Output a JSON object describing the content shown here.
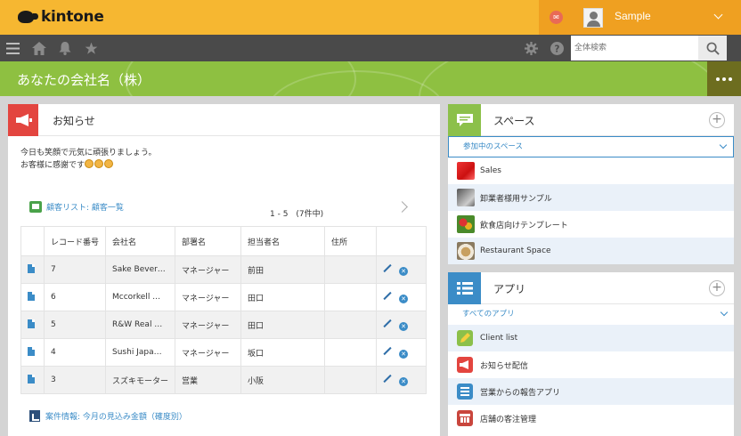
{
  "brand": {
    "name": "kintone"
  },
  "user": {
    "name": "Sample"
  },
  "search": {
    "placeholder": "全体検索"
  },
  "nav": {
    "icons": [
      "menu-icon",
      "home-icon",
      "bell-icon",
      "star-icon",
      "gear-icon",
      "help-icon"
    ]
  },
  "space_header": {
    "title": "あなたの会社名（株）"
  },
  "announcement": {
    "title": "お知らせ",
    "line1": "今日も笑顔で元気に頑張りましょう。",
    "line2": "お客様に感謝です"
  },
  "record_list": {
    "link_label": "顧客リスト: 顧客一覧",
    "pager": "1 - 5　(7件中)",
    "headers": [
      "レコード番号",
      "会社名",
      "部署名",
      "担当者名",
      "住所"
    ],
    "rows": [
      {
        "id": "7",
        "company": "Sake Bever…",
        "dept": "マネージャー",
        "person": "前田",
        "address": ""
      },
      {
        "id": "6",
        "company": "Mccorkell …",
        "dept": "マネージャー",
        "person": "田口",
        "address": ""
      },
      {
        "id": "5",
        "company": "R&W Real …",
        "dept": "マネージャー",
        "person": "田口",
        "address": ""
      },
      {
        "id": "4",
        "company": "Sushi Japa…",
        "dept": "マネージャー",
        "person": "坂口",
        "address": ""
      },
      {
        "id": "3",
        "company": "スズキモーター",
        "dept": "営業",
        "person": "小阪",
        "address": ""
      }
    ]
  },
  "deal_link": {
    "label": "案件情報: 今月の見込み金額（確度別）"
  },
  "spaces_panel": {
    "title": "スペース",
    "filter": "参加中のスペース",
    "items": [
      "Sales",
      "卸業者様用サンプル",
      "飲食店向けテンプレート",
      "Restaurant Space"
    ]
  },
  "apps_panel": {
    "title": "アプリ",
    "filter": "すべてのアプリ",
    "items": [
      "Client list",
      "お知らせ配信",
      "営業からの報告アプリ",
      "店舗の客注管理"
    ]
  },
  "colors": {
    "topbar": "#f6b731",
    "navbar": "#4a4a4a",
    "space_header": "#8ec041",
    "link": "#3b8cc7",
    "announce_accent": "#e3453f"
  }
}
